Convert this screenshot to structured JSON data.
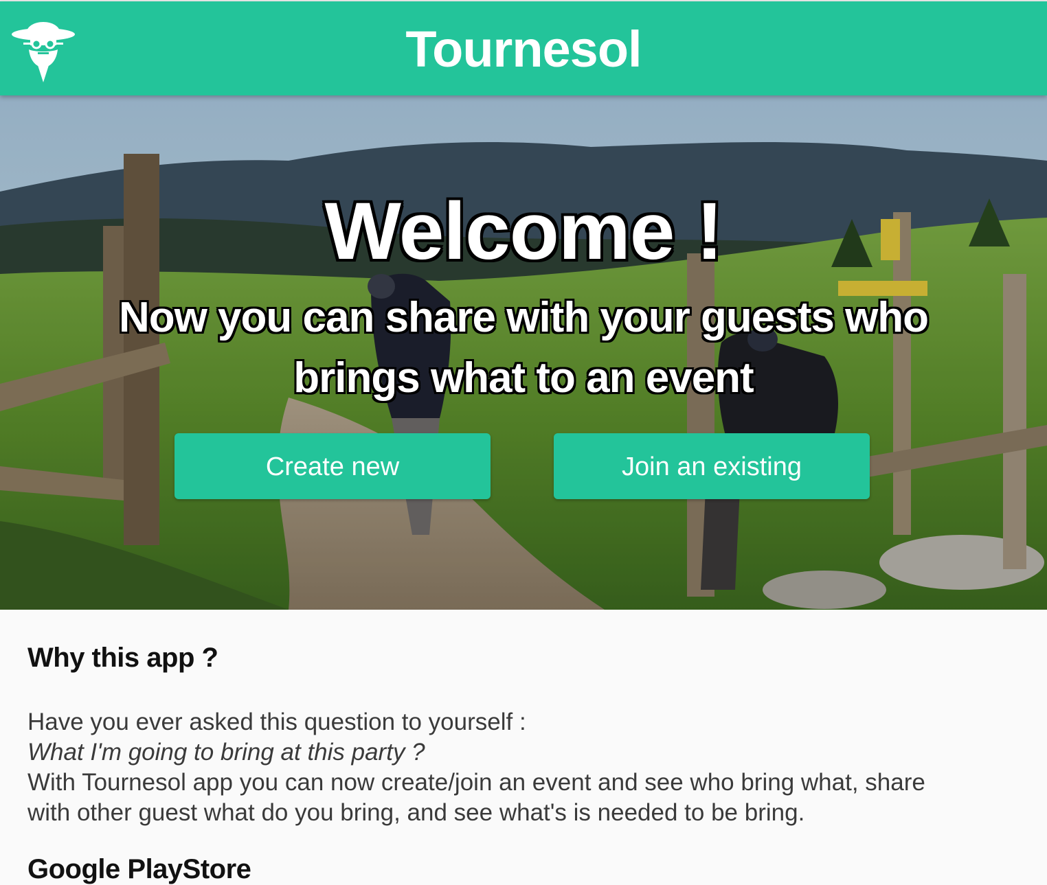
{
  "header": {
    "title": "Tournesol",
    "logo_icon": "tournesol-bearded-man-logo-icon",
    "background_color": "#23c49a"
  },
  "hero": {
    "welcome": "Welcome !",
    "tagline_line1": "Now you can share with your guests who",
    "tagline_line2": "brings what to an event",
    "create_button": "Create new",
    "join_button": "Join an existing",
    "background_image": "hikers-mountain-meadow-photo"
  },
  "about": {
    "title": "Why this app ?",
    "line1": "Have you ever asked this question to yourself :",
    "line2": "What I'm going to bring at this party ?",
    "line3": "With Tournesol app you can now create/join an event and see who bring what, share",
    "line4": "with other guest what do you bring, and see what's is needed to be bring."
  },
  "store": {
    "title": "Google PlayStore"
  },
  "colors": {
    "accent": "#23c49a",
    "text": "#3a3a3a",
    "heading": "#111111",
    "page_background": "#fafafa"
  }
}
